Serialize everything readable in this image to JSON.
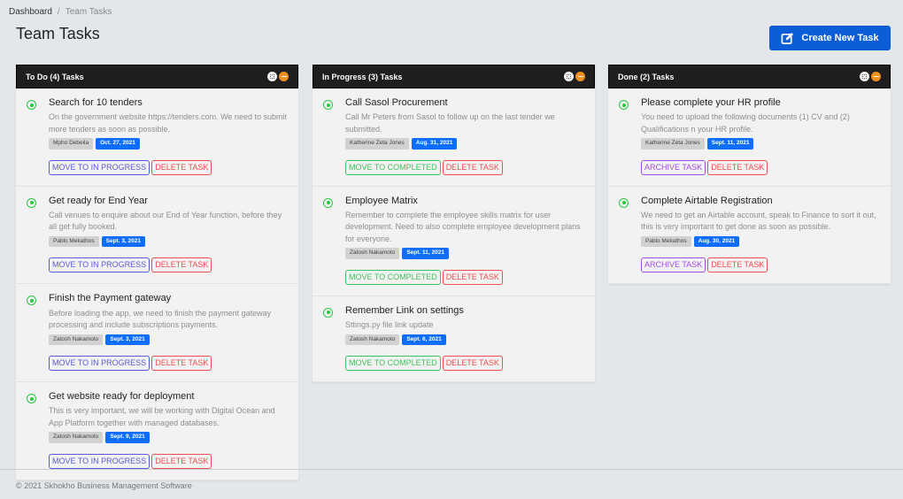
{
  "breadcrumb": {
    "root": "Dashboard",
    "separator": "/",
    "current": "Team Tasks"
  },
  "page_title": "Team Tasks",
  "create_button": {
    "label": "Create New Task",
    "icon": "edit-icon"
  },
  "colors": {
    "accent": "#0b5ed7",
    "header_bg": "#1e1e1e",
    "status_icon": "#28c840",
    "move_progress": "#5b5bd6",
    "move_completed": "#3fc25b",
    "archive": "#a24de6",
    "delete": "#ef4e4e",
    "date_badge": "#0d6efd"
  },
  "columns": [
    {
      "title": "To Do (4) Tasks",
      "tasks": [
        {
          "title": "Search for 10 tenders",
          "description": "On the government website https://tenders.com. We need to submit more tenders as soon as possible.",
          "assignee": "Mpho Debeila",
          "date": "Oct. 27, 2021",
          "primary_action": "MOVE TO IN PROGRESS",
          "delete_action": "DELETE TASK"
        },
        {
          "title": "Get ready for End Year",
          "description": "Call venues to enquire about our End of Year function, before they all get fully booked.",
          "assignee": "Pablo Mekathos",
          "date": "Sept. 3, 2021",
          "primary_action": "MOVE TO IN PROGRESS",
          "delete_action": "DELETE TASK"
        },
        {
          "title": "Finish the Payment gateway",
          "description": "Before loading the app, we need to finish the payment gateway processing and include subscriptions payments.",
          "assignee": "Zatosh Nakamoto",
          "date": "Sept. 3, 2021",
          "primary_action": "MOVE TO IN PROGRESS",
          "delete_action": "DELETE TASK"
        },
        {
          "title": "Get website ready for deployment",
          "description": "This is very important, we will be working with Digital Ocean and App Platform together with managed databases.",
          "assignee": "Zatosh Nakamoto",
          "date": "Sept. 9, 2021",
          "primary_action": "MOVE TO IN PROGRESS",
          "delete_action": "DELETE TASK"
        }
      ]
    },
    {
      "title": "In Progress (3) Tasks",
      "tasks": [
        {
          "title": "Call Sasol Procurement",
          "description": "Call Mr Peters from Sasol to follow up on the last tender we submitted.",
          "assignee": "Katherine Zeta Jones",
          "date": "Aug. 31, 2021",
          "primary_action": "MOVE TO COMPLETED",
          "delete_action": "DELETE TASK"
        },
        {
          "title": "Employee Matrix",
          "description": "Remember to complete the employee skills matrix for user development. Need to also complete employee development plans for everyone.",
          "assignee": "Zatosh Nakamoto",
          "date": "Sept. 11, 2021",
          "primary_action": "MOVE TO COMPLETED",
          "delete_action": "DELETE TASK"
        },
        {
          "title": "Remember Link on settings",
          "description": "Sttings.py file link update",
          "assignee": "Zatosh Nakamoto",
          "date": "Sept. 6, 2021",
          "primary_action": "MOVE TO COMPLETED",
          "delete_action": "DELETE TASK"
        }
      ]
    },
    {
      "title": "Done (2) Tasks",
      "tasks": [
        {
          "title": "Please complete your HR profile",
          "description": "You need to upload the following documents (1) CV and (2) Qualifications n your HR profile.",
          "assignee": "Katherine Zeta Jones",
          "date": "Sept. 11, 2021",
          "primary_action": "ARCHIVE TASK",
          "delete_action": "DELETE TASK"
        },
        {
          "title": "Complete Airtable Registration",
          "description": "We need to get an Airtable account, speak to Finance to sort it out, this is very important to get done as soon as possible.",
          "assignee": "Pablo Mekathos",
          "date": "Aug. 30, 2021",
          "primary_action": "ARCHIVE TASK",
          "delete_action": "DELETE TASK"
        }
      ]
    }
  ],
  "footer": "© 2021 Skhokho Business Management Software"
}
